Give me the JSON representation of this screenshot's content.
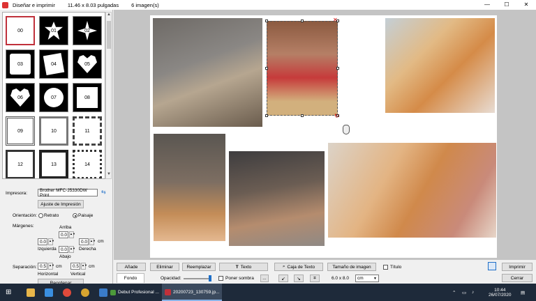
{
  "titlebar": {
    "title": "Diseñar e imprimir",
    "size": "11.46 x 8.03 pulgadas",
    "count": "6 imagen(s)",
    "min": "—",
    "max": "☐",
    "close": "✕"
  },
  "frames": [
    "00",
    "01",
    "02",
    "03",
    "04",
    "05",
    "06",
    "07",
    "08",
    "09",
    "10",
    "11",
    "12",
    "13",
    "14"
  ],
  "settings": {
    "printer_label": "Impresora:",
    "printer_value": "Brother MFC-J5330DW Print",
    "setup_button": "Ajuste de Impresión",
    "orientation_label": "Orientación:",
    "portrait": "Retrato",
    "landscape": "Paisaje",
    "margins_label": "Márgenes:",
    "top_label": "Arriba",
    "top_value": "0.0",
    "left_label": "Izquierda",
    "left_value": "0.0",
    "right_label": "Derecha",
    "right_value": "0.0",
    "bottom_label": "Abajo",
    "bottom_value": "0.0",
    "unit": "cm",
    "separation_label": "Separación:",
    "h_value": "0.5",
    "h_label": "Horizontal",
    "v_value": "0.5",
    "v_label": "Vertical",
    "reorder_button": "Reordenar"
  },
  "toolbar": {
    "add": "Añade",
    "delete": "Eliminar",
    "replace": "Reemplazar",
    "text": "Texto",
    "textbox": "Caja de Texto",
    "image_size": "Tamaño de imagen",
    "title_chk": "Título",
    "print": "Imprimir",
    "close": "Cerrar",
    "background": "Fondo",
    "opacity": "Opacidad:",
    "shadow": "Poner sombra",
    "more": "...",
    "dims": "6.0 x 8.0",
    "unit_select": "cm"
  },
  "taskbar": {
    "app1": "Debut Profesional ...",
    "app2": "20200723_130759.jp...",
    "time": "10:44",
    "date": "26/07/2020"
  }
}
